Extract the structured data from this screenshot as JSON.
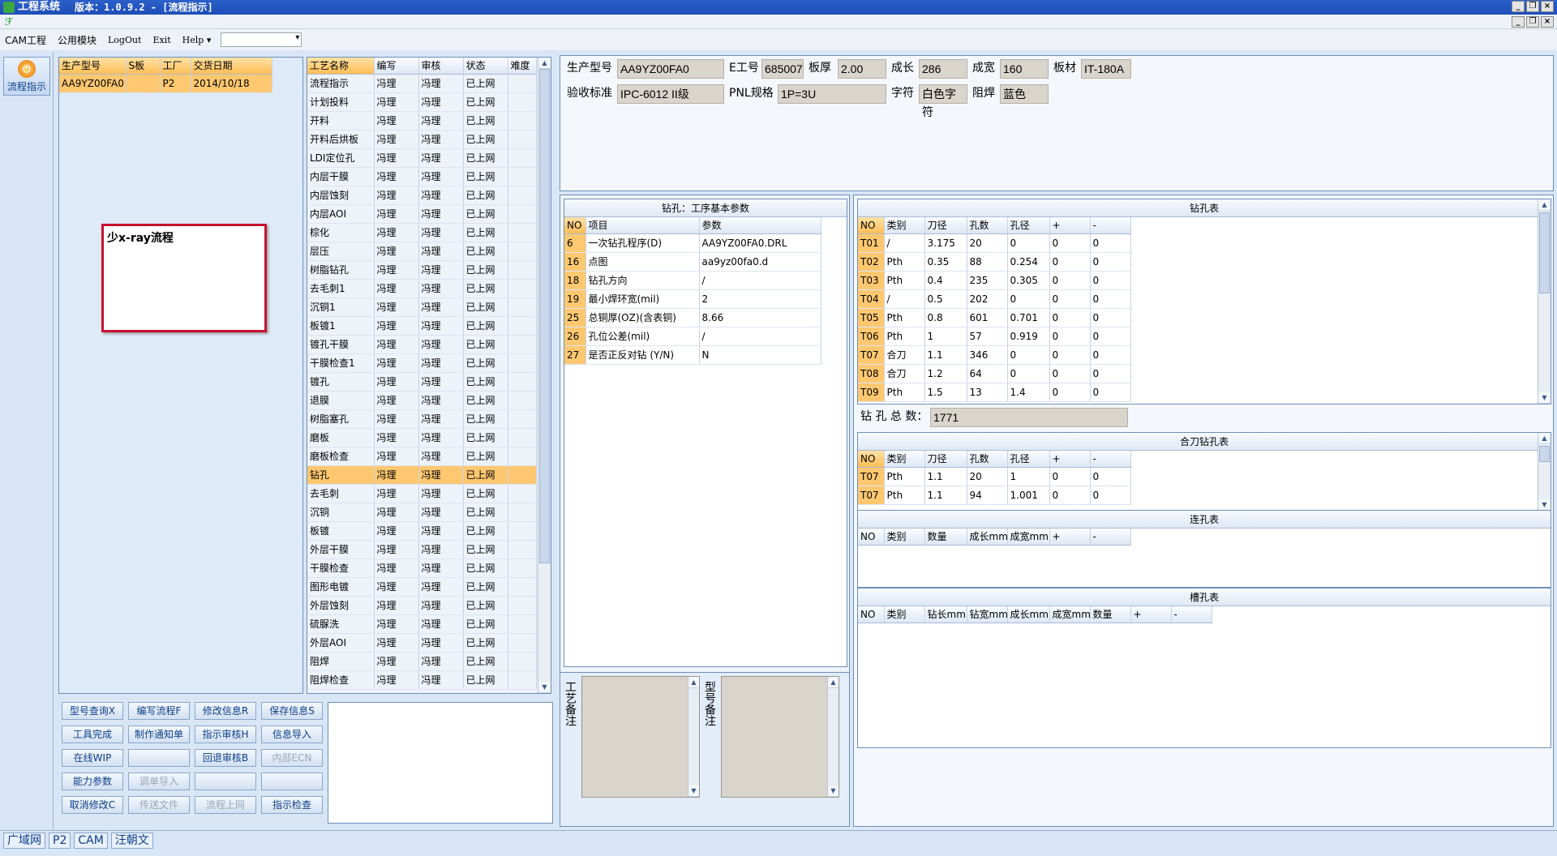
{
  "window": {
    "title": "工程系统",
    "version": "版本：1.0.9.2 - [流程指示]"
  },
  "menu": {
    "items": [
      "CAM工程",
      "公用模块",
      "LogOut",
      "Exit",
      "Help"
    ],
    "help_arrow": "▾",
    "combo_value": ""
  },
  "rail": {
    "button_label": "流程指示"
  },
  "orders": {
    "headers": [
      "生产型号",
      "S板",
      "工厂",
      "交货日期"
    ],
    "rows": [
      [
        "AA9YZ00FA0",
        "",
        "P2",
        "2014/10/18"
      ]
    ]
  },
  "note": {
    "text": "少x-ray流程"
  },
  "process": {
    "headers": [
      "工艺名称",
      "编写",
      "审核",
      "状态",
      "难度"
    ],
    "rows": [
      [
        "流程指示",
        "冯理",
        "冯理",
        "已上网",
        ""
      ],
      [
        "计划投料",
        "冯理",
        "冯理",
        "已上网",
        ""
      ],
      [
        "开料",
        "冯理",
        "冯理",
        "已上网",
        ""
      ],
      [
        "开料后烘板",
        "冯理",
        "冯理",
        "已上网",
        ""
      ],
      [
        "LDI定位孔",
        "冯理",
        "冯理",
        "已上网",
        ""
      ],
      [
        "内层干膜",
        "冯理",
        "冯理",
        "已上网",
        ""
      ],
      [
        "内层蚀刻",
        "冯理",
        "冯理",
        "已上网",
        ""
      ],
      [
        "内层AOI",
        "冯理",
        "冯理",
        "已上网",
        ""
      ],
      [
        "棕化",
        "冯理",
        "冯理",
        "已上网",
        ""
      ],
      [
        "层压",
        "冯理",
        "冯理",
        "已上网",
        ""
      ],
      [
        "树脂钻孔",
        "冯理",
        "冯理",
        "已上网",
        ""
      ],
      [
        "去毛刺1",
        "冯理",
        "冯理",
        "已上网",
        ""
      ],
      [
        "沉铜1",
        "冯理",
        "冯理",
        "已上网",
        ""
      ],
      [
        "板镀1",
        "冯理",
        "冯理",
        "已上网",
        ""
      ],
      [
        "镀孔干膜",
        "冯理",
        "冯理",
        "已上网",
        ""
      ],
      [
        "干膜检查1",
        "冯理",
        "冯理",
        "已上网",
        ""
      ],
      [
        "镀孔",
        "冯理",
        "冯理",
        "已上网",
        ""
      ],
      [
        "退膜",
        "冯理",
        "冯理",
        "已上网",
        ""
      ],
      [
        "树脂塞孔",
        "冯理",
        "冯理",
        "已上网",
        ""
      ],
      [
        "磨板",
        "冯理",
        "冯理",
        "已上网",
        ""
      ],
      [
        "磨板检查",
        "冯理",
        "冯理",
        "已上网",
        ""
      ],
      [
        "钻孔",
        "冯理",
        "冯理",
        "已上网",
        ""
      ],
      [
        "去毛刺",
        "冯理",
        "冯理",
        "已上网",
        ""
      ],
      [
        "沉铜",
        "冯理",
        "冯理",
        "已上网",
        ""
      ],
      [
        "板镀",
        "冯理",
        "冯理",
        "已上网",
        ""
      ],
      [
        "外层干膜",
        "冯理",
        "冯理",
        "已上网",
        ""
      ],
      [
        "干膜检查",
        "冯理",
        "冯理",
        "已上网",
        ""
      ],
      [
        "图形电镀",
        "冯理",
        "冯理",
        "已上网",
        ""
      ],
      [
        "外层蚀刻",
        "冯理",
        "冯理",
        "已上网",
        ""
      ],
      [
        "硫脲洗",
        "冯理",
        "冯理",
        "已上网",
        ""
      ],
      [
        "外层AOI",
        "冯理",
        "冯理",
        "已上网",
        ""
      ],
      [
        "阻焊",
        "冯理",
        "冯理",
        "已上网",
        ""
      ],
      [
        "阻焊检查",
        "冯理",
        "冯理",
        "已上网",
        ""
      ]
    ],
    "selected_index": 21
  },
  "buttons": [
    [
      "型号查询X",
      "编写流程F",
      "修改信息R",
      "保存信息S"
    ],
    [
      "工具完成",
      "制作通知单",
      "指示审核H",
      "信息导入"
    ],
    [
      "在线WIP",
      "",
      "回退审核B",
      "内部ECN"
    ],
    [
      "能力参数",
      "调单导入",
      "",
      ""
    ],
    [
      "取消修改C",
      "传送文件",
      "流程上网",
      "指示检查"
    ]
  ],
  "info": {
    "model_label": "生产型号",
    "model": "AA9YZ00FA0",
    "eno_label": "E工号",
    "eno": "685007",
    "thick_label": "板厚",
    "thick": "2.00",
    "len_label": "成长",
    "len": "286",
    "wid_label": "成宽",
    "wid": "160",
    "mat_label": "板材",
    "mat": "IT-180A",
    "std_label": "验收标准",
    "std": "IPC-6012 II级",
    "pnl_label": "PNL规格",
    "pnl": "1P=3U",
    "char_label": "字符",
    "char": "白色字符",
    "mask_label": "阻焊",
    "mask": "蓝色"
  },
  "params": {
    "title": "钻孔：工序基本参数",
    "headers": [
      "NO",
      "项目",
      "参数"
    ],
    "rows": [
      [
        "6",
        "一次钻孔程序(D)",
        "AA9YZ00FA0.DRL"
      ],
      [
        "16",
        "点图",
        "aa9yz00fa0.d"
      ],
      [
        "18",
        "钻孔方向",
        "/"
      ],
      [
        "19",
        "最小焊环宽(mil)",
        "2"
      ],
      [
        "25",
        "总铜厚(OZ)(含表铜)",
        "8.66"
      ],
      [
        "26",
        "孔位公差(mil)",
        "/"
      ],
      [
        "27",
        "是否正反对钻 (Y/N)",
        "N"
      ]
    ]
  },
  "remarks": {
    "process": "工艺备注",
    "model": "型号备注"
  },
  "drill": {
    "title": "钻孔表",
    "headers": [
      "NO",
      "类别",
      "刀径",
      "孔数",
      "孔径",
      "+",
      "-"
    ],
    "rows": [
      [
        "T01",
        "/",
        "3.175",
        "20",
        "0",
        "0",
        "0"
      ],
      [
        "T02",
        "Pth",
        "0.35",
        "88",
        "0.254",
        "0",
        "0"
      ],
      [
        "T03",
        "Pth",
        "0.4",
        "235",
        "0.305",
        "0",
        "0"
      ],
      [
        "T04",
        "/",
        "0.5",
        "202",
        "0",
        "0",
        "0"
      ],
      [
        "T05",
        "Pth",
        "0.8",
        "601",
        "0.701",
        "0",
        "0"
      ],
      [
        "T06",
        "Pth",
        "1",
        "57",
        "0.919",
        "0",
        "0"
      ],
      [
        "T07",
        "合刀",
        "1.1",
        "346",
        "0",
        "0",
        "0"
      ],
      [
        "T08",
        "合刀",
        "1.2",
        "64",
        "0",
        "0",
        "0"
      ],
      [
        "T09",
        "Pth",
        "1.5",
        "13",
        "1.4",
        "0",
        "0"
      ]
    ],
    "total_label": "钻 孔 总 数：",
    "total": "1771"
  },
  "merge": {
    "title": "合刀钻孔表",
    "headers": [
      "NO",
      "类别",
      "刀径",
      "孔数",
      "孔径",
      "+",
      "-"
    ],
    "rows": [
      [
        "T07",
        "Pth",
        "1.1",
        "20",
        "1",
        "0",
        "0"
      ],
      [
        "T07",
        "Pth",
        "1.1",
        "94",
        "1.001",
        "0",
        "0"
      ]
    ]
  },
  "link": {
    "title": "连孔表",
    "headers": [
      "NO",
      "类别",
      "数量",
      "成长mm",
      "成宽mm",
      "+",
      "-"
    ]
  },
  "slot": {
    "title": "槽孔表",
    "headers": [
      "NO",
      "类别",
      "钻长mm",
      "钻宽mm",
      "成长mm",
      "成宽mm",
      "数量",
      "+",
      "-"
    ]
  },
  "status": [
    "广域网",
    "P2",
    "CAM",
    "汪朝文"
  ]
}
